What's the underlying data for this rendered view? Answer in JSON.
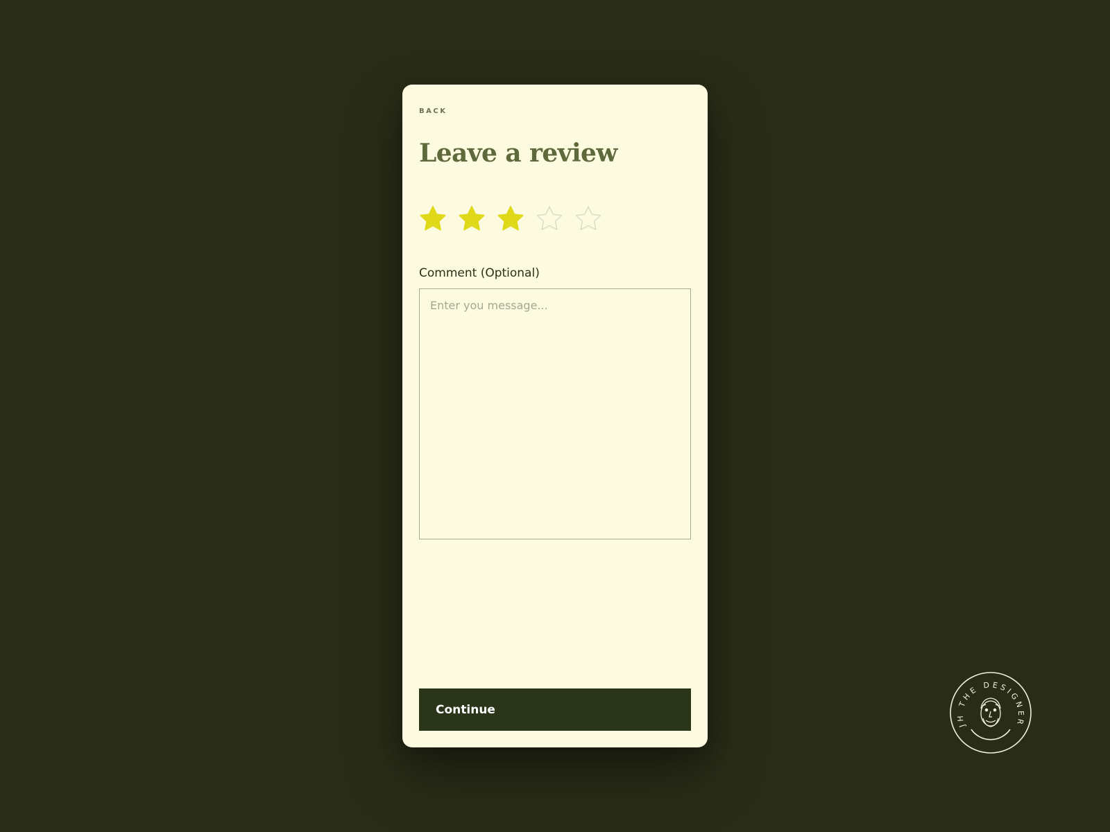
{
  "nav": {
    "back_label": "BACK"
  },
  "page": {
    "title": "Leave a review"
  },
  "rating": {
    "value": 3,
    "max": 5,
    "filled_color": "#e0d91a",
    "empty_color": "#d8d9c6"
  },
  "comment": {
    "label": "Comment (Optional)",
    "placeholder": "Enter you message...",
    "value": ""
  },
  "actions": {
    "continue_label": "Continue"
  },
  "colors": {
    "background": "#292d18",
    "card": "#fdfbdf",
    "title": "#5f6a3c",
    "button": "#2a3519"
  },
  "watermark": {
    "text": "JH THE DESIGNER"
  }
}
